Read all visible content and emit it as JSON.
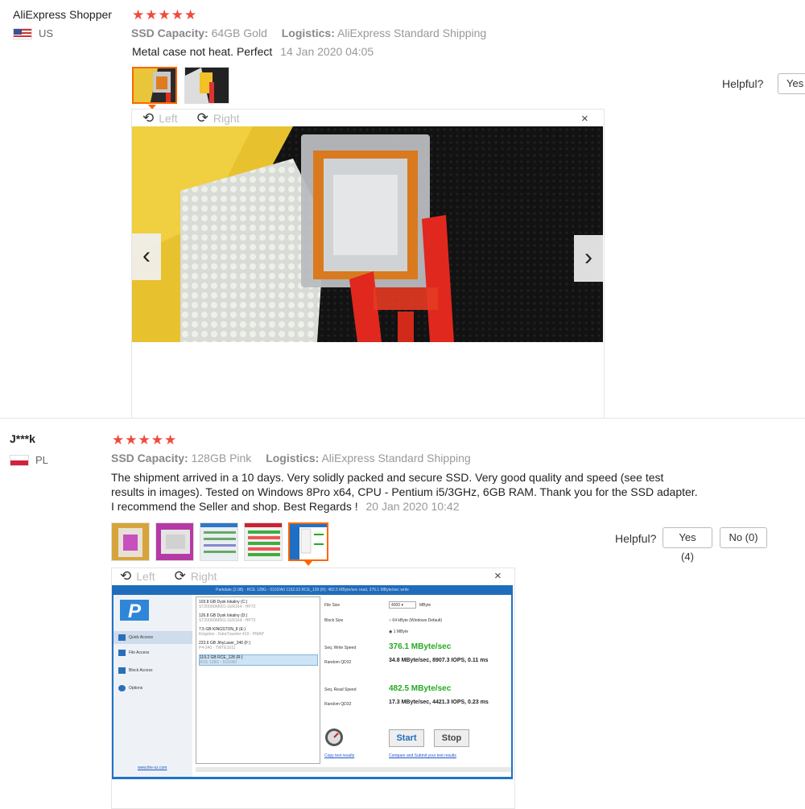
{
  "reviews": [
    {
      "user": "AliExpress Shopper",
      "country": "US",
      "stars": "★★★★★",
      "attr1_label": "SSD Capacity:",
      "attr1_value": "64GB Gold",
      "attr2_label": "Logistics:",
      "attr2_value": "AliExpress Standard Shipping",
      "text": "Metal case not heat. Perfect",
      "date": "14 Jan 2020 04:05",
      "helpful_label": "Helpful?",
      "yes_label": "Yes",
      "viewer": {
        "rotate_left": "Left",
        "rotate_right": "Right",
        "close": "×",
        "prev": "‹",
        "next": "›"
      }
    },
    {
      "user": "J***k",
      "country": "PL",
      "stars": "★★★★★",
      "attr1_label": "SSD Capacity:",
      "attr1_value": "128GB Pink",
      "attr2_label": "Logistics:",
      "attr2_value": "AliExpress Standard Shipping",
      "text": "The shipment arrived in a 10 days. Very solidly packed and secure SSD. Very good quality and speed (see test results in images). Tested on Windows 8Pro x64, CPU - Pentium i5/3GHz, 6GB RAM. Thank you for the SSD adapter. I recommend the Seller and shop. Best Regards !",
      "date": "20 Jan 2020 10:42",
      "helpful_label": "Helpful?",
      "yes_label": "Yes (4)",
      "no_label": "No (0)",
      "viewer": {
        "rotate_left": "Left",
        "rotate_right": "Right",
        "close": "×"
      }
    }
  ],
  "benchmark": {
    "title": "Parkdale (2.98) - RCE 128G - 5102/A0 1152.03 RCE_128 (R): 482.5 MByte/sec read, 376.1 MByte/sec write",
    "menu": [
      "Quick Access",
      "File Access",
      "Block Access",
      "Options"
    ],
    "drives": [
      {
        "name": "103.8 GB Dysk lokalny (C:)",
        "sub": "ST2000DM001-1ER164 - HP73"
      },
      {
        "name": "126.8 GB Dysk lokalny (D:)",
        "sub": "ST2000DM001-1ER164 - HP73"
      },
      {
        "name": "7.5 GB KINGSTON_8 (E:)",
        "sub": "Kingston - DataTraveler 410 - PMAP"
      },
      {
        "name": "223.6 GB JihyLaser_240 (F:)",
        "sub": "P4-240 - TWTE1011"
      },
      {
        "name": "119.2 GB RCE_128 (R:)",
        "sub": "RCE 128G - 5102A0"
      }
    ],
    "file_size_label": "File Size",
    "file_size_value": "4000",
    "file_size_unit": "MByte",
    "block_size_label": "Block Size",
    "block_opt1": "64 kByte (Windows Default)",
    "block_opt2": "1 MByte",
    "seq_write_label": "Seq. Write Speed",
    "seq_write_value": "376.1 MByte/sec",
    "random_label": "Random QD32",
    "random_write_value": "34.8 MByte/sec, 8907.3 IOPS, 0.11 ms",
    "seq_read_label": "Seq. Read Speed",
    "seq_read_value": "482.5 MByte/sec",
    "random_read_value": "17.3 MByte/sec, 4421.3 IOPS, 0.23 ms",
    "start_label": "Start",
    "stop_label": "Stop",
    "copy_link": "Copy test results",
    "compare_link": "Compare and Submit your test results",
    "site_link": "www.the-sz.com"
  },
  "colors": {
    "star": "#f04a3c",
    "accent": "#ff6600",
    "win_blue": "#1f73c7",
    "green_result": "#22aa22"
  }
}
